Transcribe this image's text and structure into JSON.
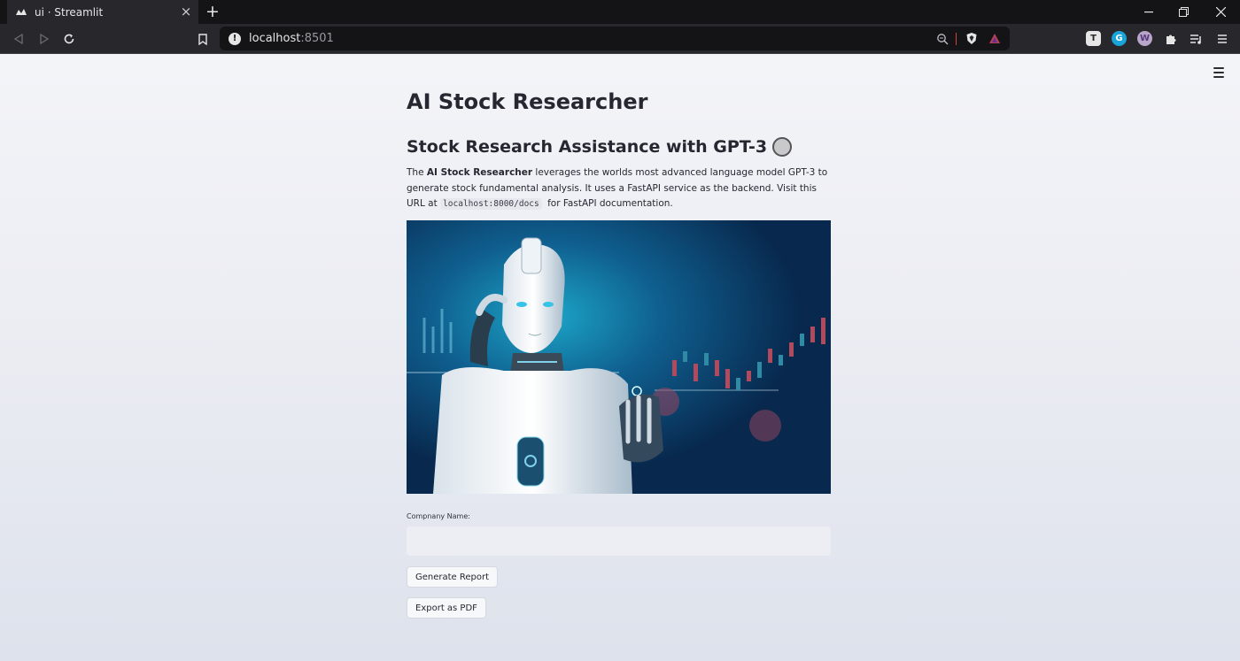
{
  "browser": {
    "tab_title": "ui · Streamlit",
    "url_host": "localhost",
    "url_port": ":8501"
  },
  "page": {
    "title": "AI Stock Researcher",
    "subtitle": "Stock Research Assistance with GPT-3",
    "description": {
      "part1": "The ",
      "app_name": "AI Stock Researcher",
      "part2": " leverages the worlds most advanced language model GPT-3 to generate stock fundamental analysis. It uses a FastAPI service as the backend. Visit this URL at ",
      "docs_url": "localhost:8000/docs",
      "part3": " for FastAPI documentation."
    },
    "company_label": "Compnany Name:",
    "company_value": "",
    "generate_label": "Generate Report",
    "export_label": "Export as PDF"
  },
  "colors": {
    "accent_robot_bg": "#0b3f6b",
    "candle_red": "#b04a5c",
    "candle_green": "#2f8aa6"
  }
}
